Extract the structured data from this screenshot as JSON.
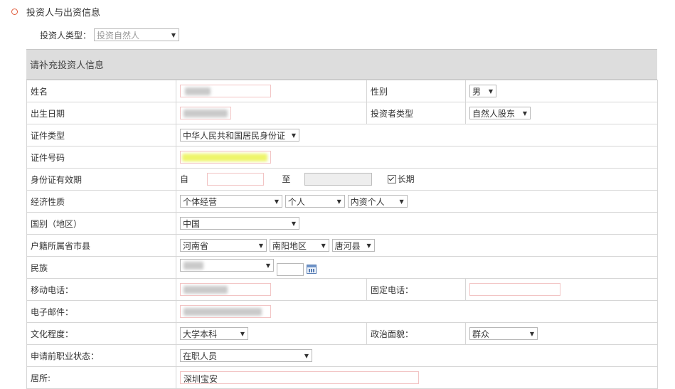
{
  "section": {
    "title": "投资人与出资信息"
  },
  "investor_type": {
    "label": "投资人类型：",
    "value": "投资自然人"
  },
  "form": {
    "header": "请补充投资人信息",
    "name": {
      "label": "姓名"
    },
    "gender": {
      "label": "性别",
      "value": "男"
    },
    "birth_date": {
      "label": "出生日期"
    },
    "investor_category": {
      "label": "投资者类型",
      "value": "自然人股东"
    },
    "id_type": {
      "label": "证件类型",
      "value": "中华人民共和国居民身份证"
    },
    "id_number": {
      "label": "证件号码"
    },
    "id_validity": {
      "label": "身份证有效期",
      "from_label": "自",
      "to_label": "至",
      "long_term_label": "长期"
    },
    "economic_nature": {
      "label": "经济性质",
      "value1": "个体经营",
      "value2": "个人",
      "value3": "内资个人"
    },
    "country": {
      "label": "国别（地区）",
      "value": "中国"
    },
    "household": {
      "label": "户籍所属省市县",
      "province": "河南省",
      "city": "南阳地区",
      "county": "唐河县"
    },
    "ethnicity": {
      "label": "民族"
    },
    "mobile": {
      "label": "移动电话："
    },
    "landline": {
      "label": "固定电话："
    },
    "email": {
      "label": "电子邮件："
    },
    "education": {
      "label": "文化程度：",
      "value": "大学本科"
    },
    "political_status": {
      "label": "政治面貌：",
      "value": "群众"
    },
    "employment_status": {
      "label": "申请前职业状态：",
      "value": "在职人员"
    },
    "residence": {
      "label": "居所:",
      "value": "深圳宝安"
    }
  }
}
